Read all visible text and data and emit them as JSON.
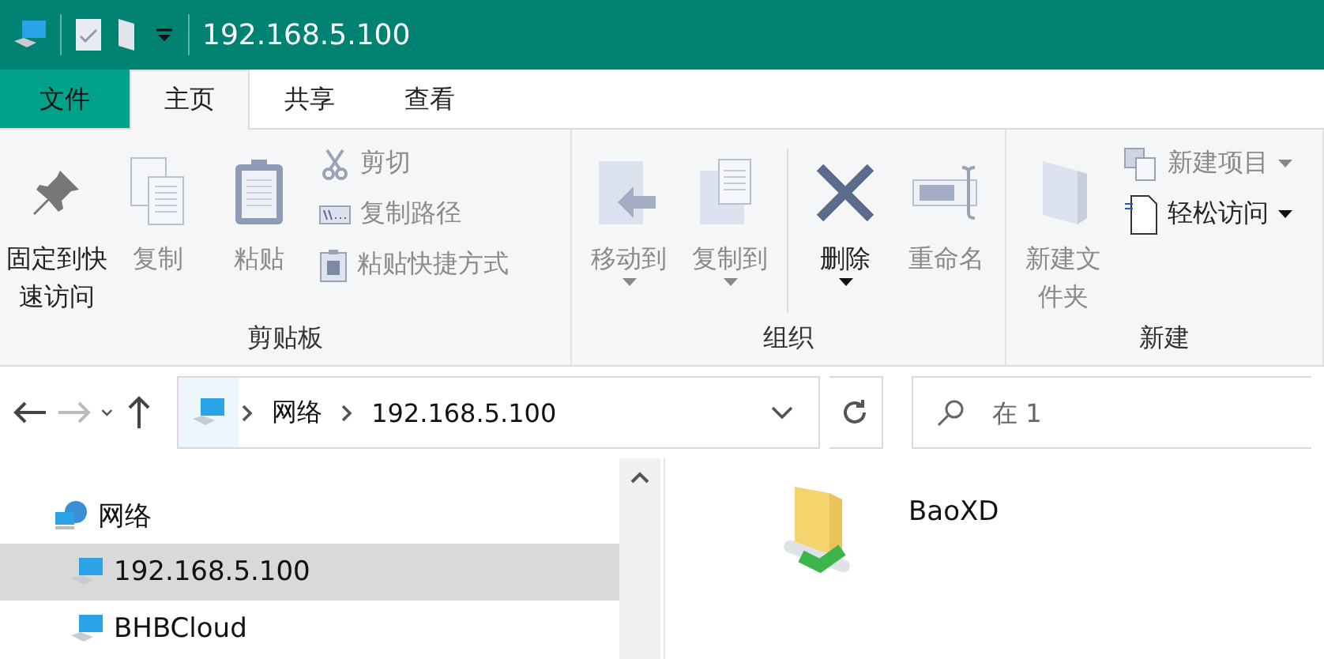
{
  "window": {
    "title": "192.168.5.100"
  },
  "tabs": [
    {
      "label": "文件",
      "kind": "file",
      "selected": false
    },
    {
      "label": "主页",
      "kind": "tab",
      "selected": true
    },
    {
      "label": "共享",
      "kind": "tab",
      "selected": false
    },
    {
      "label": "查看",
      "kind": "tab",
      "selected": false
    }
  ],
  "ribbon": {
    "groups": [
      {
        "label": "剪贴板",
        "items": [
          {
            "kind": "large",
            "label": "固定到快速访问",
            "disabled": false,
            "dropdown": false
          },
          {
            "kind": "large",
            "label": "复制",
            "disabled": true,
            "dropdown": false
          },
          {
            "kind": "large",
            "label": "粘贴",
            "disabled": true,
            "dropdown": false
          },
          {
            "kind": "small",
            "label": "剪切",
            "disabled": true,
            "dropdown": false
          },
          {
            "kind": "small",
            "label": "复制路径",
            "disabled": true,
            "dropdown": false
          },
          {
            "kind": "small",
            "label": "粘贴快捷方式",
            "disabled": true,
            "dropdown": false
          }
        ]
      },
      {
        "label": "组织",
        "items": [
          {
            "kind": "large",
            "label": "移动到",
            "disabled": true,
            "dropdown": true
          },
          {
            "kind": "large",
            "label": "复制到",
            "disabled": true,
            "dropdown": true
          },
          {
            "kind": "separator"
          },
          {
            "kind": "large",
            "label": "删除",
            "disabled": false,
            "dropdown": true
          },
          {
            "kind": "large",
            "label": "重命名",
            "disabled": true,
            "dropdown": false
          }
        ]
      },
      {
        "label": "新建",
        "items": [
          {
            "kind": "large",
            "label": "新建文件夹",
            "disabled": true,
            "dropdown": false
          },
          {
            "kind": "small",
            "label": "新建项目",
            "disabled": true,
            "dropdown": true
          },
          {
            "kind": "small",
            "label": "轻松访问",
            "disabled": false,
            "dropdown": true
          }
        ]
      }
    ]
  },
  "navigation": {
    "back_disabled": false,
    "forward_disabled": true
  },
  "address": {
    "segments": [
      "网络",
      "192.168.5.100"
    ]
  },
  "search": {
    "placeholder": "在 1"
  },
  "tree": [
    {
      "label": "网络",
      "selected": false,
      "children": [
        {
          "label": "192.168.5.100",
          "selected": true
        },
        {
          "label": "BHBCloud",
          "selected": false
        }
      ]
    }
  ],
  "files": [
    {
      "name": "BaoXD"
    }
  ]
}
